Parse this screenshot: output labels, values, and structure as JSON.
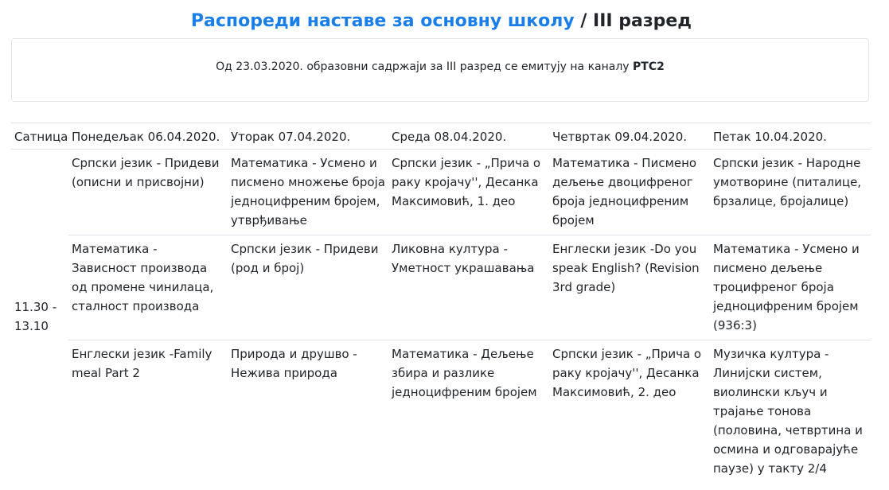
{
  "page": {
    "title_link": "Распореди наставе за основну школу",
    "title_sep": " / ",
    "title_grade": "III разред"
  },
  "notice": {
    "text_before": "Од 23.03.2020. образовни садржаји за III разред се емитују на каналу ",
    "channel": "РТС2"
  },
  "schedule": {
    "headers": [
      "Сатница",
      "Понедељак 06.04.2020.",
      "Уторак 07.04.2020.",
      "Среда 08.04.2020.",
      "Четвртак 09.04.2020.",
      "Петак 10.04.2020."
    ],
    "time": "11.30 - 13.10",
    "rows": [
      [
        "Српски језик - Придеви (описни и присвојни)",
        "Математика - Усмено и писмено множење броја једноцифреним бројем, утврђивање",
        "Српски језик - „Прича о раку кројачу'', Десанка Максимовић, 1. део",
        "Математика - Писмено дељење двоцифреног броја једноцифреним бројем",
        "Српски језик - Народне умотворине (питалице, брзалице, бројалице)"
      ],
      [
        "Математика - Зависност производа од промене чинилаца, сталност производа",
        "Српски језик - Придеви (род и број)",
        " Ликовна култура - Уметност украшавања",
        "Енглески језик -Do you speak English? (Revision 3rd grade)",
        "Математика - Усмено и писмено дељење троцифреног броја једноцифреним бројем (936:3)"
      ],
      [
        "Енглески језик -Family meal Part 2",
        " Природа и друшво - Нежива природа",
        "Математика - Дељење збира и разлике једноцифреним бројем",
        " Српски језик - „Прича о раку кројачу'', Десанка Максимовић, 2. део",
        "Музичка култура - Линијски систем, виолински кључ и трајање тонова (половина, четвртина и осмина и одговарајуће паузе) у такту 2/4"
      ]
    ]
  },
  "colors": {
    "link": "#1a7ee8",
    "text": "#212529",
    "border": "#dee2e6"
  }
}
